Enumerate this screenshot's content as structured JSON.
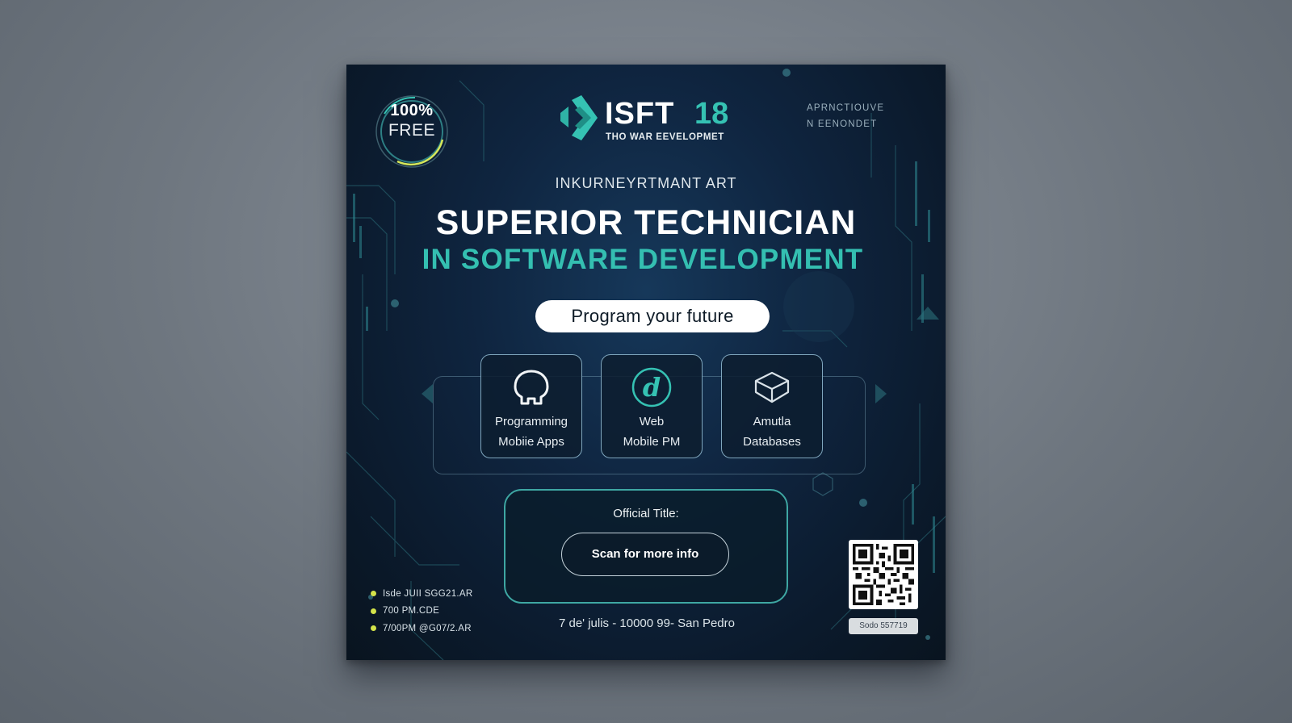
{
  "badge": {
    "line1": "100%",
    "line2": "FREE"
  },
  "logo": {
    "name": "ISFT",
    "number": "18",
    "tagline": "THO WAR EEVELOPMET"
  },
  "top_right": {
    "line1": "APRNCTIOUVE",
    "line2": "N EENONDET"
  },
  "kicker": "INKURNEYRTMANT ART",
  "title": {
    "line1": "SUPERIOR TECHNICIAN",
    "line2": "IN SOFTWARE DEVELOPMENT"
  },
  "slogan_button": "Program your future",
  "cards": [
    {
      "icon": "head-icon",
      "line1": "Programming",
      "line2": "Mobiie Apps"
    },
    {
      "icon": "web-icon",
      "line1": "Web",
      "line2": "Mobile PM"
    },
    {
      "icon": "database-cube-icon",
      "line1": "Amutla",
      "line2": "Databases"
    }
  ],
  "official": {
    "label": "Official Title:",
    "button": "Scan for more info"
  },
  "bullets": [
    "Isde JUII SGG21.AR",
    "700 PM.CDE",
    "7/00PM @G07/2.AR"
  ],
  "dateline": "7 de' julis - 10000 99- San Pedro",
  "qr": {
    "code_label": "Sodo 557719"
  },
  "colors": {
    "accent": "#35c2b3",
    "background": "#0f2540",
    "bullet_dot": "#d4e34a"
  }
}
